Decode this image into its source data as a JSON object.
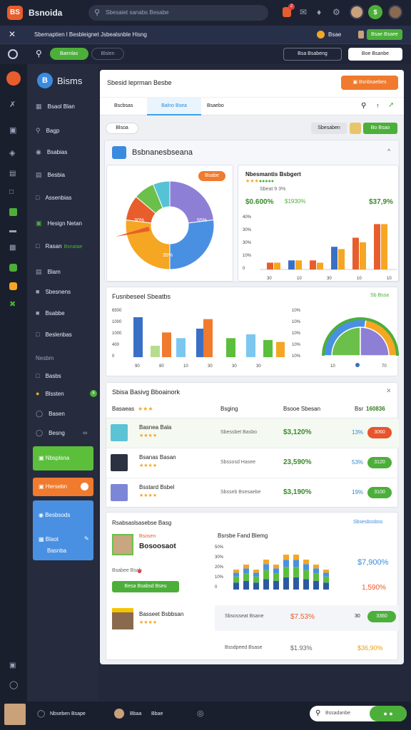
{
  "app": {
    "name": "Bsnoida",
    "search_placeholder": "Sbesaiet sanabs Besabe",
    "top_badge": "2"
  },
  "row2": {
    "breadcrumb": "Sbemaptien l Besbleignet Jsbealsnble Hisng",
    "status": "Bsae",
    "btn_label": "Bsae Bsaee"
  },
  "row3": {
    "chip1": "Baenlas",
    "chip2": "Blslen",
    "btn1": "Bsa Bsabeng",
    "btn2": "Boe Bsanbe"
  },
  "sidebar": {
    "brand": "Bisms",
    "items": [
      "Bsaol Blan",
      "Bagp",
      "Bsabias",
      "Besbia",
      "Assenbias",
      "Hesign Netan",
      "Rasan",
      "Blam",
      "Sbesnens",
      "Bsabbe",
      "Beslenbas"
    ],
    "item6_tag": "Bsnatae",
    "section": "Nesbm",
    "sub_items": [
      "Basbs",
      "Blssten",
      "Basen",
      "Besng"
    ],
    "sub_badge": "6",
    "green_btn": "Nbsplsna",
    "orange_btn": "Hersebn",
    "blue_panel": {
      "title": "Besbsods",
      "line1": "Blaot",
      "line2": "Basnba"
    }
  },
  "main": {
    "title": "Sbesid leprman Besbe",
    "action": "Bsnbsaebes",
    "tabs": [
      "Bscbsas",
      "Balno Bsea",
      "Bsaebo"
    ],
    "filter": "Blsoa",
    "btn_grey": "Sbesaben",
    "btn_green": "Bo Bsao"
  },
  "analytics": {
    "title": "Bsbnanesbseana",
    "collapse": "^",
    "donut_btn": "Bsabe",
    "donut_labels": [
      "30%",
      "55%",
      "35%"
    ],
    "bar_title": "Nbesmantis Bsbgert",
    "bar_sub1": "Sbeat 9 3%",
    "val_a": "$0.600%",
    "val_b": "$1930%",
    "val_c": "$37,9%",
    "y_ticks": [
      "40%",
      "30%",
      "30%",
      "10%",
      "0"
    ],
    "x_ticks": [
      "30",
      "10",
      "30",
      "10",
      "10"
    ]
  },
  "chart_data": [
    {
      "type": "pie",
      "values": [
        30,
        35,
        35,
        12,
        10,
        8
      ],
      "colors": [
        "#8e7fd6",
        "#4a90e2",
        "#f5a623",
        "#e85d2c",
        "#6bc04b",
        "#56c2d6"
      ],
      "labels": [
        "30%",
        "55%",
        "35%"
      ]
    },
    {
      "type": "bar",
      "title": "Nbesmantis Bsbgert",
      "categories": [
        "30",
        "10",
        "30",
        "10",
        "10"
      ],
      "series": [
        {
          "values": [
            3,
            4,
            4,
            10,
            14,
            20
          ]
        },
        {
          "values": [
            3,
            4,
            3,
            9,
            12,
            20
          ]
        }
      ],
      "y_tick_labels": [
        "40%",
        "30%",
        "30%",
        "10%",
        "0"
      ]
    },
    {
      "type": "bar",
      "title": "Fusnbeseel Sbeatbs",
      "categories": [
        "90",
        "80",
        "10",
        "30",
        "30",
        "30"
      ],
      "values": [
        4.2,
        1.2,
        2.6,
        2.0,
        3.0,
        4.0,
        2.0,
        2.4,
        1.8
      ],
      "y_tick_labels": [
        "6500",
        "1000",
        "1000",
        "400",
        "0"
      ]
    },
    {
      "type": "pie",
      "values": [
        40,
        35,
        25
      ],
      "colors": [
        "#4a90e2",
        "#f5a623",
        "#6bc04b"
      ],
      "labels": [
        "10%",
        "10%",
        "10%",
        "10%",
        "10%"
      ]
    },
    {
      "type": "bar",
      "title": "Bsrsbe Fand Blemg",
      "values": [
        4,
        5,
        4,
        6,
        5,
        7,
        7,
        6,
        5,
        4
      ],
      "y_tick_labels": [
        "50%",
        "30%",
        "20%",
        "10%",
        "0"
      ]
    }
  ],
  "panel2": {
    "title": "Fusnbeseel Sbeatbs",
    "badge": "Sb Bssa",
    "y": [
      "6500",
      "1000",
      "1000",
      "400",
      "0"
    ],
    "x": [
      "30",
      "80",
      "10",
      "30",
      "30",
      "30"
    ],
    "gy": [
      "10%",
      "10%",
      "10%",
      "10%",
      "10%"
    ],
    "gx": [
      "10",
      "70"
    ]
  },
  "table": {
    "title": "Sbisa Basivg Bboainork",
    "head": [
      "Basaeas",
      "Bsging",
      "Bsooe Sbesan",
      "Bsr"
    ],
    "head_val": "160836",
    "rows": [
      {
        "name": "Basnea Bala",
        "sub": "Sbessbet Basbo",
        "val": "$3,120%",
        "pct": "13%",
        "btn": "3060",
        "btn_color": "#e8542c",
        "icon_bg": "#5cc2d6"
      },
      {
        "name": "Bsanas Basan",
        "sub": "Sbssosd Hasee",
        "val": "23,590%",
        "pct": "53%",
        "btn": "3120",
        "btn_color": "#4caf3a",
        "icon_bg": "#2b3242"
      },
      {
        "name": "Bsstard Bsbel",
        "sub": "Sbsseb Bsesaebe",
        "val": "$3,190%",
        "pct": "19%",
        "btn": "3100",
        "btn_color": "#4caf3a",
        "icon_bg": "#7b86d6"
      }
    ]
  },
  "bottom_card": {
    "title": "Rsabsaslsasebse Basg",
    "person": {
      "tag": "Bsosen",
      "name": "Bosoosaot",
      "meta": "Bsabee Bsab",
      "btn": "Besa Bsabsd Bseu"
    },
    "chart_title": "Bsrsbe Fand Blemg",
    "chart_right": "Sbsesbssbss",
    "y": [
      "50%",
      "30%",
      "20%",
      "10%",
      "0"
    ],
    "v1": "$7,900%",
    "v2": "1,590%",
    "person2": {
      "name": "Basseet Bsbbsan"
    },
    "rows": [
      {
        "label": "Sbsosseat Bsane",
        "val": "$7.53%",
        "num": "30",
        "btn": "3360"
      },
      {
        "label": "Bssdpeed Bsase",
        "val": "$1.93%",
        "val2": "$36,90%"
      }
    ]
  },
  "bottom": {
    "item1": "Nbseben Bsape",
    "item2": "Bbaa",
    "item3": "Bbae",
    "search": "Bssadanbe"
  }
}
